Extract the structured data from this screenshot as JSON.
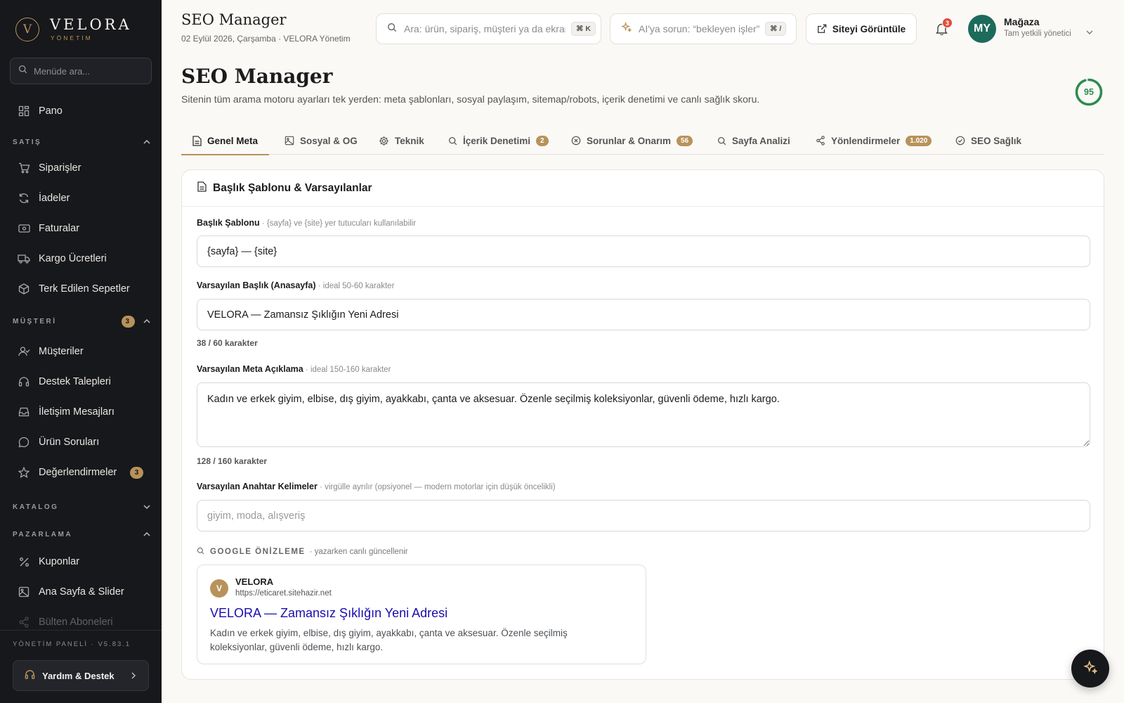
{
  "brand": {
    "mark": "V",
    "name": "VELORA",
    "sub": "YÖNETİM"
  },
  "sidebar": {
    "search_placeholder": "Menüde ara...",
    "pano": "Pano",
    "sections": {
      "satis": "SATIŞ",
      "musteri": "MÜŞTERİ",
      "musteri_badge": "3",
      "katalog": "KATALOG",
      "pazarlama": "PAZARLAMA"
    },
    "items": {
      "siparisler": "Siparişler",
      "iadeler": "İadeler",
      "faturalar": "Faturalar",
      "kargo": "Kargo Ücretleri",
      "terk": "Terk Edilen Sepetler",
      "musteriler": "Müşteriler",
      "destek": "Destek Talepleri",
      "iletisim": "İletişim Mesajları",
      "urun_sorulari": "Ürün Soruları",
      "degerlendirmeler": "Değerlendirmeler",
      "degerlendirmeler_badge": "3",
      "kuponlar": "Kuponlar",
      "anasayfa": "Ana Sayfa & Slider",
      "bulten": "Bülten Aboneleri"
    },
    "version": "YÖNETİM PANELİ · V5.83.1",
    "help": "Yardım & Destek"
  },
  "topbar": {
    "title": "SEO Manager",
    "subtitle": "02 Eylül 2026, Çarşamba · VELORA Yönetim",
    "search_placeholder": "Ara: ürün, sipariş, müşteri ya da ekran",
    "search_kbd": "⌘ K",
    "ai_placeholder": "AI'ya sorun: “bekleyen işler”",
    "ai_kbd": "⌘ /",
    "view_site": "Siteyi Görüntüle",
    "notifications": "3",
    "user_initials": "MY",
    "user_name": "Mağaza",
    "user_role": "Tam yetkili yönetici"
  },
  "page": {
    "title": "SEO Manager",
    "description": "Sitenin tüm arama motoru ayarları tek yerden: meta şablonları, sosyal paylaşım, sitemap/robots, içerik denetimi ve canlı sağlık skoru.",
    "score": "95"
  },
  "tabs": [
    {
      "label": "Genel Meta"
    },
    {
      "label": "Sosyal & OG"
    },
    {
      "label": "Teknik"
    },
    {
      "label": "İçerik Denetimi",
      "badge": "2"
    },
    {
      "label": "Sorunlar & Onarım",
      "badge": "56"
    },
    {
      "label": "Sayfa Analizi"
    },
    {
      "label": "Yönlendirmeler",
      "badge": "1.020"
    },
    {
      "label": "SEO Sağlık"
    }
  ],
  "card": {
    "title": "Başlık Şablonu & Varsayılanlar",
    "title_template": {
      "label": "Başlık Şablonu",
      "hint": " · {sayfa} ve {site} yer tutucuları kullanılabilir",
      "value": "{sayfa} — {site}"
    },
    "default_title": {
      "label": "Varsayılan Başlık (Anasayfa)",
      "hint": " · ideal 50-60 karakter",
      "value": "VELORA — Zamansız Şıklığın Yeni Adresi",
      "counter": "38 / 60 karakter"
    },
    "meta_description": {
      "label": "Varsayılan Meta Açıklama",
      "hint": " · ideal 150-160 karakter",
      "value": "Kadın ve erkek giyim, elbise, dış giyim, ayakkabı, çanta ve aksesuar. Özenle seçilmiş koleksiyonlar, güvenli ödeme, hızlı kargo.",
      "counter": "128 / 160 karakter"
    },
    "keywords": {
      "label": "Varsayılan Anahtar Kelimeler",
      "hint": " · virgülle ayrılır (opsiyonel — modern motorlar için düşük öncelikli)",
      "placeholder": "giyim, moda, alışveriş"
    },
    "preview": {
      "heading": "GOOGLE ÖNİZLEME",
      "sub": "· yazarken canlı güncellenir",
      "favicon": "V",
      "site": "VELORA",
      "url": "https://eticaret.sitehazir.net",
      "title": "VELORA — Zamansız Şıklığın Yeni Adresi",
      "description": "Kadın ve erkek giyim, elbise, dış giyim, ayakkabı, çanta ve aksesuar. Özenle seçilmiş koleksiyonlar, güvenli ödeme, hızlı kargo."
    }
  },
  "colors": {
    "accent": "#b8925a",
    "sidebar": "#17181b",
    "score": "#2e8b4e",
    "link": "#1a0dab"
  }
}
